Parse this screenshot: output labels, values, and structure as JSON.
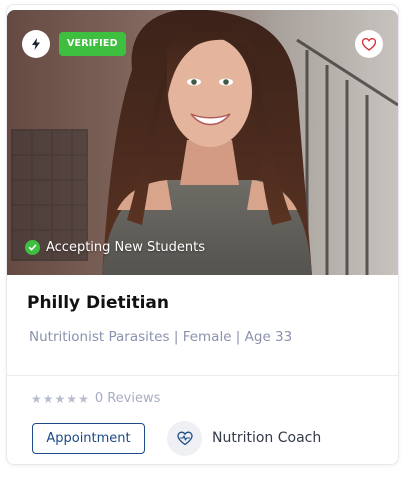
{
  "badges": {
    "verified_label": "VERIFIED",
    "accepting_label": "Accepting New Students"
  },
  "profile": {
    "name": "Philly Dietitian",
    "specialty": "Nutritionist Parasites",
    "gender": "Female",
    "age": "Age 33",
    "separator": "|"
  },
  "rating": {
    "stars_filled": 0,
    "stars_total": 5,
    "reviews_label": "0 Reviews"
  },
  "actions": {
    "appointment_label": "Appointment",
    "coach_label": "Nutrition Coach"
  },
  "icons": {
    "bolt": "lightning-bolt-icon",
    "heart": "heart-icon",
    "check": "check-circle-icon",
    "coach": "heart-pulse-icon"
  },
  "colors": {
    "verified": "#3fbf3f",
    "accent": "#1e4a86",
    "heart": "#d9333f",
    "muted_text": "#8b92ad",
    "star": "#b7bdcf"
  }
}
